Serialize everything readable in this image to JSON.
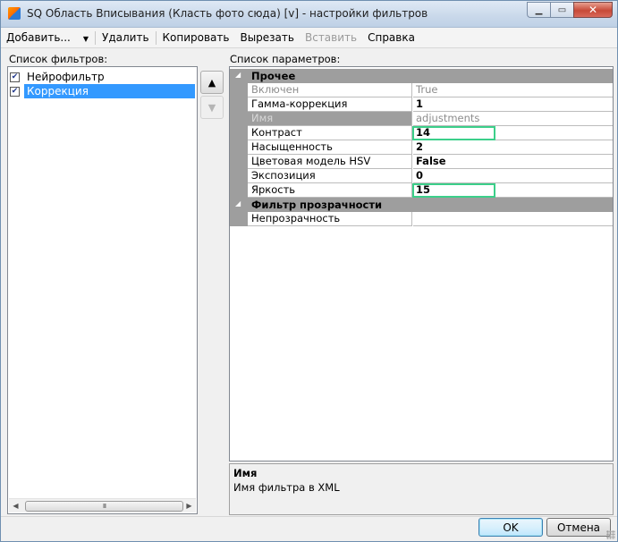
{
  "window": {
    "title": "SQ Область Вписывания (Класть фото сюда) [v] - настройки фильтров",
    "minimize": "▁",
    "maximize": "▭",
    "close": "✕"
  },
  "toolbar": {
    "add": "Добавить...",
    "add_arrow": "▼",
    "delete": "Удалить",
    "copy": "Копировать",
    "cut": "Вырезать",
    "paste": "Вставить",
    "help": "Справка"
  },
  "filters": {
    "label": "Список фильтров:",
    "items": [
      {
        "label": "Нейрофильтр",
        "checked": true,
        "selected": false
      },
      {
        "label": "Коррекция",
        "checked": true,
        "selected": true
      }
    ],
    "move_up": "▲",
    "move_down": "▼",
    "scroll_left": "◀",
    "scroll_right": "▶",
    "scroll_grip": "III"
  },
  "params": {
    "label": "Список параметров:",
    "categories": [
      {
        "name": "Прочее",
        "expander": "◢",
        "props": [
          {
            "name": "Включен",
            "value": "True"
          },
          {
            "name": "Гамма-коррекция",
            "value": "1"
          },
          {
            "name": "Имя",
            "value": "adjustments"
          },
          {
            "name": "Контраст",
            "value": "14"
          },
          {
            "name": "Насыщенность",
            "value": "2"
          },
          {
            "name": "Цветовая модель HSV",
            "value": "False"
          },
          {
            "name": "Экспозиция",
            "value": "0"
          },
          {
            "name": "Яркость",
            "value": "15"
          }
        ]
      },
      {
        "name": "Фильтр прозрачности",
        "expander": "◢",
        "props": [
          {
            "name": "Непрозрачность",
            "value": ""
          }
        ]
      }
    ]
  },
  "description": {
    "title": "Имя",
    "text": "Имя фильтра в XML"
  },
  "buttons": {
    "ok": "OK",
    "cancel": "Отмена"
  },
  "colors": {
    "selection": "#3399ff",
    "category_bg": "#9e9e9e",
    "highlight_box": "#3ccf8a"
  }
}
